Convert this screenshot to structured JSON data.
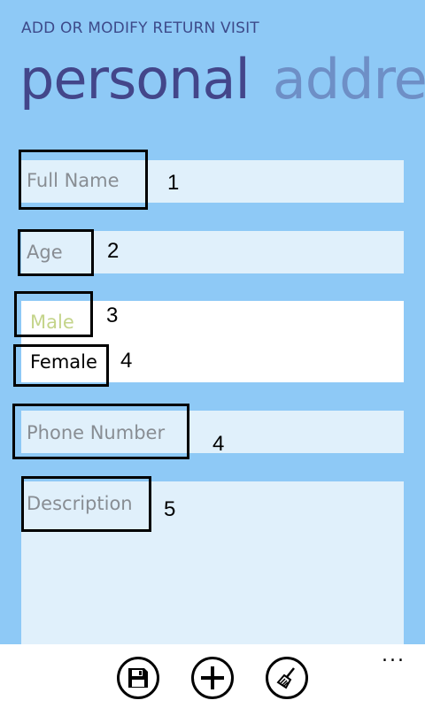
{
  "header": {
    "app_title": "ADD OR MODIFY RETURN VISIT",
    "pivot_active": "personal",
    "pivot_next": "addre"
  },
  "form": {
    "full_name_placeholder": "Full Name",
    "age_placeholder": "Age",
    "gender_options": [
      "Male",
      "Female"
    ],
    "phone_placeholder": "Phone Number",
    "description_placeholder": "Description"
  },
  "annotations": {
    "full_name": "1",
    "age": "2",
    "male": "3",
    "female": "4",
    "phone": "4",
    "description": "5"
  },
  "appbar": {
    "icons": [
      "save-icon",
      "add-icon",
      "clear-icon"
    ],
    "more_label": "..."
  },
  "colors": {
    "background": "#8ec9f6",
    "title": "#3d4a8a",
    "pivot_active": "#43468a",
    "pivot_inactive": "#6e8fc6",
    "field_bg": "#e0f0fb",
    "placeholder": "#888d93",
    "male_option": "#c4d48a"
  }
}
